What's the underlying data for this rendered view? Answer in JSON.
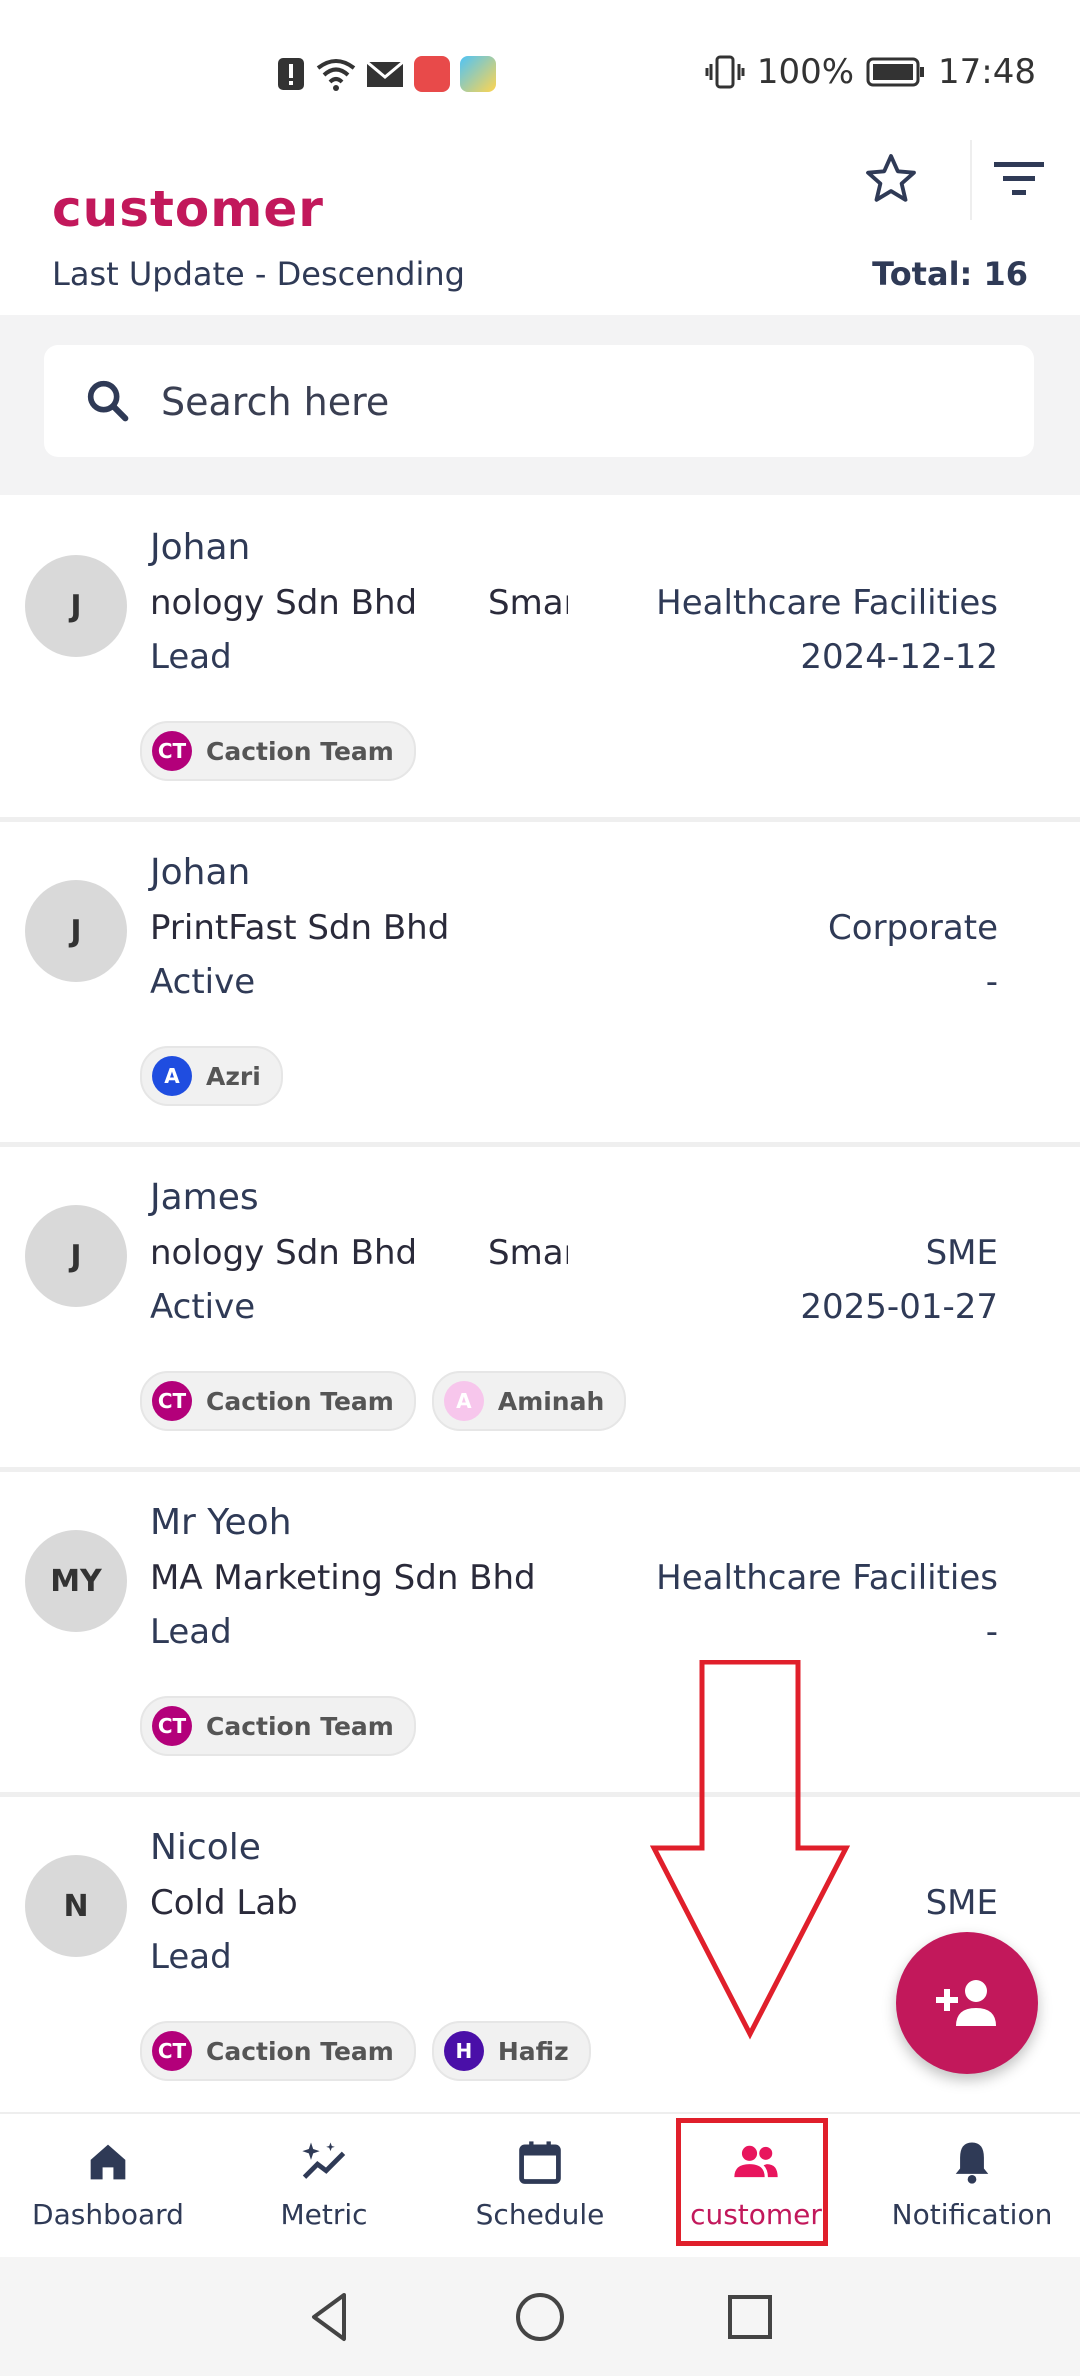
{
  "status_bar": {
    "battery": "100%",
    "time": "17:48"
  },
  "header": {
    "title": "customer",
    "sort_label": "Last Update - Descending",
    "total": "Total: 16"
  },
  "search": {
    "placeholder": "Search here"
  },
  "customers": [
    {
      "initials": "J",
      "name": "Johan",
      "company": "nology Sdn Bhd",
      "company_2": "Smaı",
      "industry": "Healthcare Facilities",
      "status": "Lead",
      "date": "2024-12-12",
      "chips": [
        {
          "initials": "CT",
          "label": "Caction Team",
          "color": "#b3007a"
        }
      ]
    },
    {
      "initials": "J",
      "name": "Johan",
      "company": "PrintFast Sdn Bhd",
      "company_2": "",
      "industry": "Corporate",
      "status": "Active",
      "date": "-",
      "chips": [
        {
          "initials": "A",
          "label": "Azri",
          "color": "#1f4de0"
        }
      ]
    },
    {
      "initials": "J",
      "name": "James",
      "company": "nology Sdn Bhd",
      "company_2": "Smaı",
      "industry": "SME",
      "status": "Active",
      "date": "2025-01-27",
      "chips": [
        {
          "initials": "CT",
          "label": "Caction Team",
          "color": "#b3007a"
        },
        {
          "initials": "A",
          "label": "Aminah",
          "color": "#f7c6ec"
        }
      ]
    },
    {
      "initials": "MY",
      "name": "Mr Yeoh",
      "company": "MA Marketing Sdn Bhd",
      "company_2": "",
      "industry": "Healthcare Facilities",
      "status": "Lead",
      "date": "-",
      "chips": [
        {
          "initials": "CT",
          "label": "Caction Team",
          "color": "#b3007a"
        }
      ]
    },
    {
      "initials": "N",
      "name": "Nicole",
      "company": "Cold Lab",
      "company_2": "",
      "industry": "SME",
      "status": "Lead",
      "date": "",
      "chips": [
        {
          "initials": "CT",
          "label": "Caction Team",
          "color": "#b3007a"
        },
        {
          "initials": "H",
          "label": "Hafiz",
          "color": "#4a0fa8"
        }
      ]
    }
  ],
  "nav": [
    {
      "label": "Dashboard",
      "icon": "home-icon",
      "active": false
    },
    {
      "label": "Metric",
      "icon": "sparkle-chart-icon",
      "active": false
    },
    {
      "label": "Schedule",
      "icon": "calendar-icon",
      "active": false
    },
    {
      "label": "customer",
      "icon": "people-icon",
      "active": true
    },
    {
      "label": "Notification",
      "icon": "bell-icon",
      "active": false
    }
  ],
  "colors": {
    "accent": "#c2185b",
    "annotation": "#e01f2b",
    "text": "#2f3a56"
  }
}
